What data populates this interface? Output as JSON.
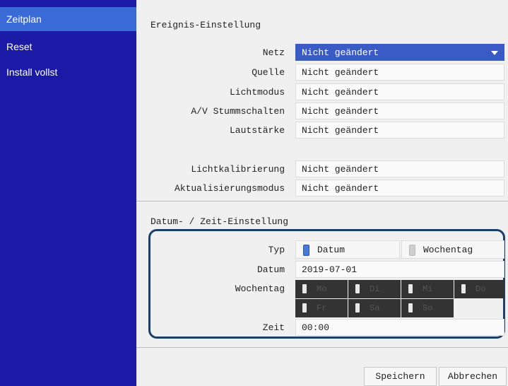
{
  "sidebar": {
    "items": [
      {
        "label": "Zeitplan"
      },
      {
        "label": "Reset"
      },
      {
        "label": "Install vollst"
      }
    ]
  },
  "event": {
    "title": "Ereignis-Einstellung",
    "rows": [
      {
        "label": "Netz",
        "value": "Nicht geändert"
      },
      {
        "label": "Quelle",
        "value": "Nicht geändert"
      },
      {
        "label": "Lichtmodus",
        "value": "Nicht geändert"
      },
      {
        "label": "A/V Stummschalten",
        "value": "Nicht geändert"
      },
      {
        "label": "Lautstärke",
        "value": "Nicht geändert"
      },
      {
        "label": "Lichtkalibrierung",
        "value": "Nicht geändert"
      },
      {
        "label": "Aktualisierungsmodus",
        "value": "Nicht geändert"
      }
    ]
  },
  "datetime": {
    "title": "Datum- / Zeit-Einstellung",
    "typ_label": "Typ",
    "typ_options": [
      "Datum",
      "Wochentag"
    ],
    "typ_selected": "Datum",
    "datum_label": "Datum",
    "datum_value": "2019-07-01",
    "wochentag_label": "Wochentag",
    "days": [
      "Mo",
      "Di",
      "Mi",
      "Do",
      "Fr",
      "Sa",
      "So"
    ],
    "zeit_label": "Zeit",
    "zeit_value": "00:00"
  },
  "buttons": {
    "save": "Speichern",
    "cancel": "Abbrechen"
  },
  "colors": {
    "sidebar_bg": "#1a1aa6",
    "sidebar_active": "#3a6ad8",
    "selected_field": "#3a5bc6",
    "highlight_border": "#1b3f6b"
  }
}
